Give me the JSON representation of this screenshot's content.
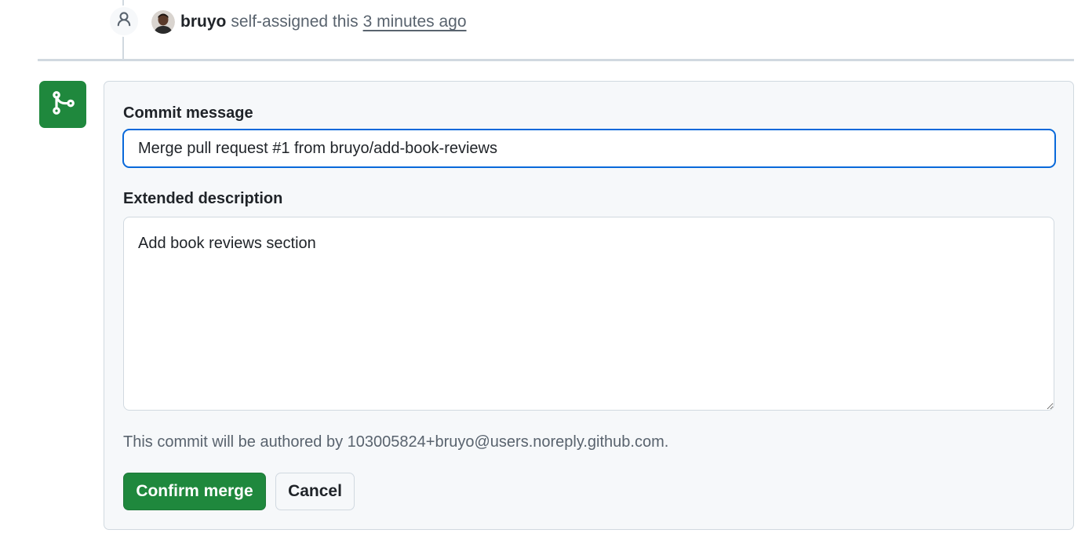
{
  "timeline_event": {
    "icon": "person-icon",
    "author": "bruyo",
    "action": "self-assigned this",
    "time": "3 minutes ago"
  },
  "merge_form": {
    "icon": "git-merge-icon",
    "icon_bg_color": "#1f883d",
    "commit_message_label": "Commit message",
    "commit_message_value": "Merge pull request #1 from bruyo/add-book-reviews",
    "extended_description_label": "Extended description",
    "extended_description_value": "Add book reviews section",
    "author_note": "This commit will be authored by 103005824+bruyo@users.noreply.github.com.",
    "confirm_label": "Confirm merge",
    "cancel_label": "Cancel",
    "accent_color": "#0969da"
  }
}
